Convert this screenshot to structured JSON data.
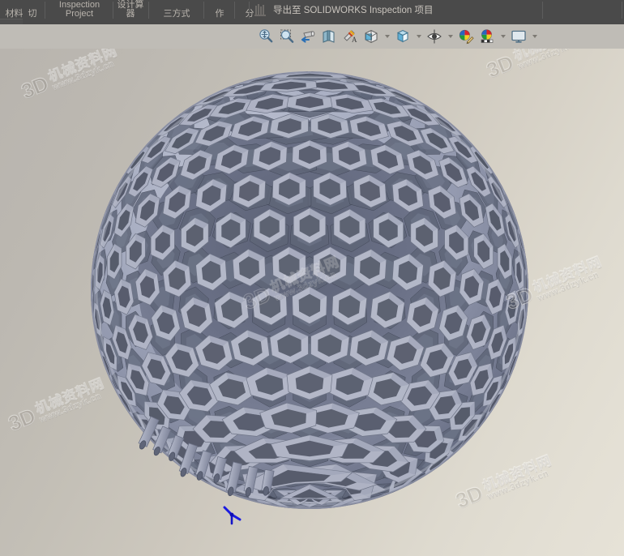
{
  "window": {
    "app": "SOLIDWORKS",
    "theme_dark": "#4a4a4a",
    "theme_toolbar": "#bfbcb6"
  },
  "ribbon": {
    "groups": [
      {
        "name": "group-cut-truncated",
        "label": "材料  切"
      },
      {
        "name": "group-inspection-project",
        "label": "Inspection\nProject"
      },
      {
        "name": "group-instrument",
        "label": "设计算\n器"
      },
      {
        "name": "group-three-dim",
        "label": "三方式"
      },
      {
        "name": "group-item",
        "label": "作"
      },
      {
        "name": "group-split",
        "label": "分"
      }
    ],
    "export_command": {
      "label": "导出至 SOLIDWORKS Inspection 项目",
      "icon": "export-inspection-icon"
    }
  },
  "tabs": {
    "active": {
      "label": "ction",
      "full": "Inspection"
    }
  },
  "toolbar": {
    "buttons": [
      {
        "name": "zoom-to-fit-button",
        "icon": "magnifier-fit-icon",
        "caret": false
      },
      {
        "name": "zoom-to-area-button",
        "icon": "magnifier-area-icon",
        "caret": false
      },
      {
        "name": "rotate-view-button",
        "icon": "rotate-view-icon",
        "caret": false
      },
      {
        "name": "section-view-button",
        "icon": "section-view-icon",
        "caret": false
      },
      {
        "name": "view-orientation-button",
        "icon": "view-orientation-icon",
        "caret": false
      },
      {
        "name": "display-style-button",
        "icon": "display-style-cube-icon",
        "caret": true
      },
      {
        "name": "hide-show-items-button",
        "icon": "hide-show-eye-icon",
        "caret": true
      },
      {
        "name": "edit-appearance-button",
        "icon": "appearance-pencil-icon",
        "caret": false
      },
      {
        "name": "apply-scene-button",
        "icon": "scene-checker-icon",
        "caret": true
      },
      {
        "name": "view-settings-button",
        "icon": "monitor-display-icon",
        "caret": true
      }
    ]
  },
  "viewport": {
    "model_name": "lattice-sphere-model",
    "model_description": "Hexagonal lattice hollow sphere with cylindrical pegs around the lower rim",
    "origin_marker": {
      "name": "origin-triad",
      "color": "#1a1ae0"
    },
    "background_colors": [
      "#b8b4ae",
      "#ccc7bd",
      "#e6e2d7"
    ],
    "lattice_colors": {
      "light": "#b5b9c9",
      "mid": "#9aa0b4",
      "dark": "#7f869c",
      "deep": "#5f6678",
      "shadow": "#3d4252",
      "rim": "#6e7486"
    }
  },
  "watermarks": [
    {
      "name": "watermark-top-left",
      "logo": "3D",
      "cn": "机械资料网",
      "url": "www.3dzyk.cn"
    },
    {
      "name": "watermark-top-right",
      "logo": "3D",
      "cn": "机械资料网",
      "url": "www.3dzyk.cn"
    },
    {
      "name": "watermark-mid-right",
      "logo": "3D",
      "cn": "机械资料网",
      "url": "www.3dzyk.cn"
    },
    {
      "name": "watermark-bottom-left",
      "logo": "3D",
      "cn": "机械资料网",
      "url": "www.3dzyk.cn"
    },
    {
      "name": "watermark-bottom-right",
      "logo": "3D",
      "cn": "机械资料网",
      "url": "www.3dzyk.cn"
    },
    {
      "name": "watermark-center",
      "logo": "3D",
      "cn": "机械资料网",
      "url": "www.3dzyk.cn"
    }
  ]
}
